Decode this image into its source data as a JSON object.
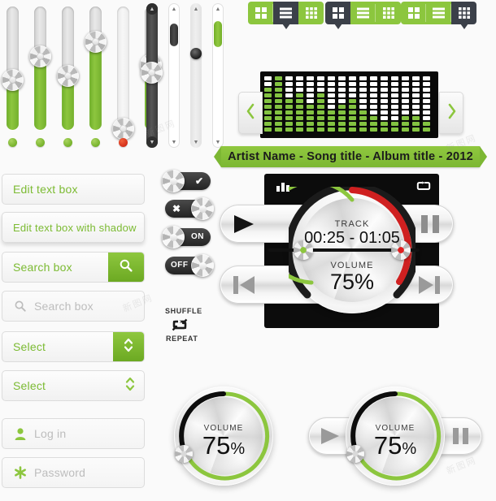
{
  "meta": {
    "title": "Media Player UI Kit"
  },
  "sliders": {
    "name": "vertical-slider-bank",
    "items": [
      {
        "id": "slider-1",
        "fill_percent": 42,
        "status": "green"
      },
      {
        "id": "slider-2",
        "fill_percent": 62,
        "status": "green"
      },
      {
        "id": "slider-3",
        "fill_percent": 45,
        "status": "green"
      },
      {
        "id": "slider-4",
        "fill_percent": 72,
        "status": "green"
      },
      {
        "id": "slider-5",
        "fill_percent": 0,
        "status": "red"
      },
      {
        "id": "slider-6",
        "fill_percent": 55,
        "status": "green"
      }
    ]
  },
  "scrollbars": {
    "name": "scroll-slider-bank",
    "items": [
      {
        "id": "scroll-dark",
        "style": "dark",
        "thumb_percent": 45,
        "thumb_type": "knob"
      },
      {
        "id": "scroll-white-dark",
        "style": "white",
        "thumb_percent": 14,
        "thumb_type": "bar-dark"
      },
      {
        "id": "scroll-grey-ball",
        "style": "grey",
        "thumb_percent": 37,
        "thumb_type": "ball"
      },
      {
        "id": "scroll-white-green",
        "style": "white",
        "thumb_percent": 12,
        "thumb_type": "bar-green"
      }
    ],
    "cap_up": "▲",
    "cap_down": "▼"
  },
  "forms": {
    "edit_text_box": {
      "label": "Edit text box",
      "shadow": false
    },
    "edit_text_box_shadow": {
      "label": "Edit text box with shadow",
      "shadow": true
    },
    "search_box_active": {
      "value": "Search box",
      "icon": "search-icon"
    },
    "search_box_placeholder": {
      "placeholder": "Search box",
      "icon": "search-icon"
    },
    "select_filled": {
      "value": "Select",
      "icon": "updown-chevron-icon"
    },
    "select_plain": {
      "value": "Select",
      "icon": "updown-chevron-icon"
    },
    "login_field": {
      "placeholder": "Log in",
      "icon": "user-icon"
    },
    "password_field": {
      "placeholder": "Password",
      "icon": "asterisk-icon"
    }
  },
  "toggles": {
    "items": [
      {
        "id": "toggle-check",
        "state": "on",
        "glyph": "✔",
        "label": "",
        "knob_side": "left"
      },
      {
        "id": "toggle-cross",
        "state": "off",
        "glyph": "✖",
        "label": "",
        "knob_side": "right"
      },
      {
        "id": "toggle-on",
        "state": "on",
        "glyph": "",
        "label": "ON",
        "knob_side": "left"
      },
      {
        "id": "toggle-off",
        "state": "off",
        "glyph": "",
        "label": "OFF",
        "knob_side": "right"
      }
    ],
    "shuffle_label": "SHUFFLE",
    "repeat_label": "REPEAT"
  },
  "icon_bars": [
    {
      "id": "icon-bar-1",
      "cells": [
        {
          "icon": "grid-4-icon",
          "active": false
        },
        {
          "icon": "list-rows-icon",
          "active": true
        },
        {
          "icon": "grid-9-icon",
          "active": false
        }
      ]
    },
    {
      "id": "icon-bar-2",
      "cells": [
        {
          "icon": "grid-4-icon",
          "active": true
        },
        {
          "icon": "list-rows-icon",
          "active": false
        },
        {
          "icon": "grid-9-icon",
          "active": false
        }
      ]
    },
    {
      "id": "icon-bar-3",
      "cells": [
        {
          "icon": "grid-4-icon",
          "active": false
        },
        {
          "icon": "list-rows-icon",
          "active": false
        },
        {
          "icon": "grid-9-icon",
          "active": true
        }
      ]
    }
  ],
  "player": {
    "now_playing": "Artist Name - Song title - Album title - 2012",
    "prev_arrow": "chevron-left-icon",
    "next_arrow": "chevron-right-icon",
    "equalizer": {
      "name": "equalizer-display",
      "columns": 16,
      "segments_per_column": 10,
      "levels": [
        8,
        10,
        6,
        7,
        5,
        7,
        4,
        5,
        6,
        4,
        3,
        2,
        2,
        3,
        3,
        2
      ]
    },
    "top_icons": {
      "eq_icon": "equalizer-bars-icon",
      "repeat_icon": "repeat-icon"
    },
    "transport": {
      "play": "play-icon",
      "pause": "pause-icon",
      "prev": "previous-track-icon",
      "next": "next-track-icon"
    },
    "dial": {
      "track_label": "TRACK",
      "track_time": "00:25 - 01:05",
      "volume_label": "VOLUME",
      "volume_value": "75%",
      "volume_percent": 75,
      "progress_percent": 38
    }
  },
  "volume_knobs": [
    {
      "id": "volume-knob-standalone",
      "label": "VOLUME",
      "value": "75",
      "unit": "%",
      "percent": 75
    },
    {
      "id": "volume-knob-with-transport",
      "label": "VOLUME",
      "value": "75",
      "unit": "%",
      "percent": 75,
      "left_button": "play-icon",
      "right_button": "pause-icon"
    }
  ],
  "colors": {
    "green": "#8cc63e",
    "green_dark": "#6ca922",
    "red": "#d5301a",
    "dark": "#3b4049",
    "black": "#0c0c0c"
  }
}
